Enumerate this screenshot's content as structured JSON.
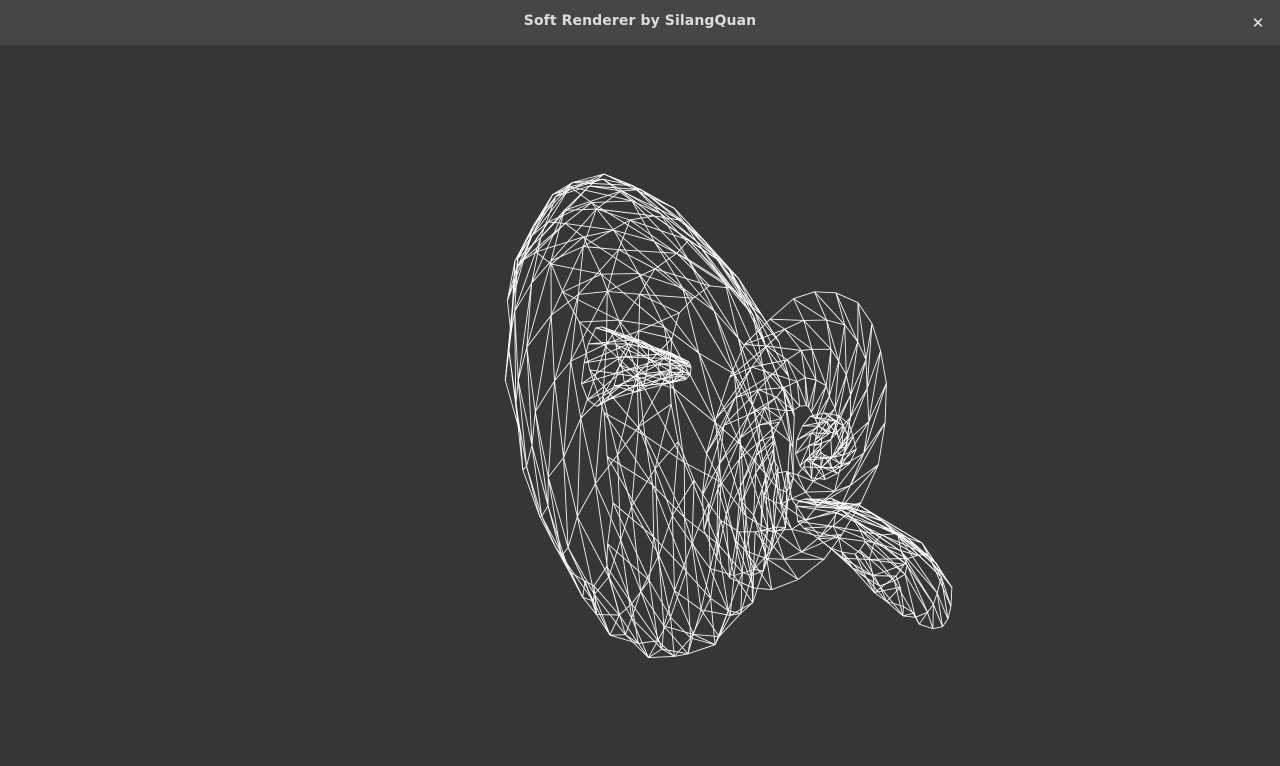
{
  "window": {
    "title": "Soft Renderer by SilangQuan",
    "close_label": "✕",
    "background_color": "#363636",
    "titlebar_color": "#464646"
  },
  "render": {
    "mode": "wireframe",
    "model": "teapot",
    "line_color": "#ffffff"
  }
}
